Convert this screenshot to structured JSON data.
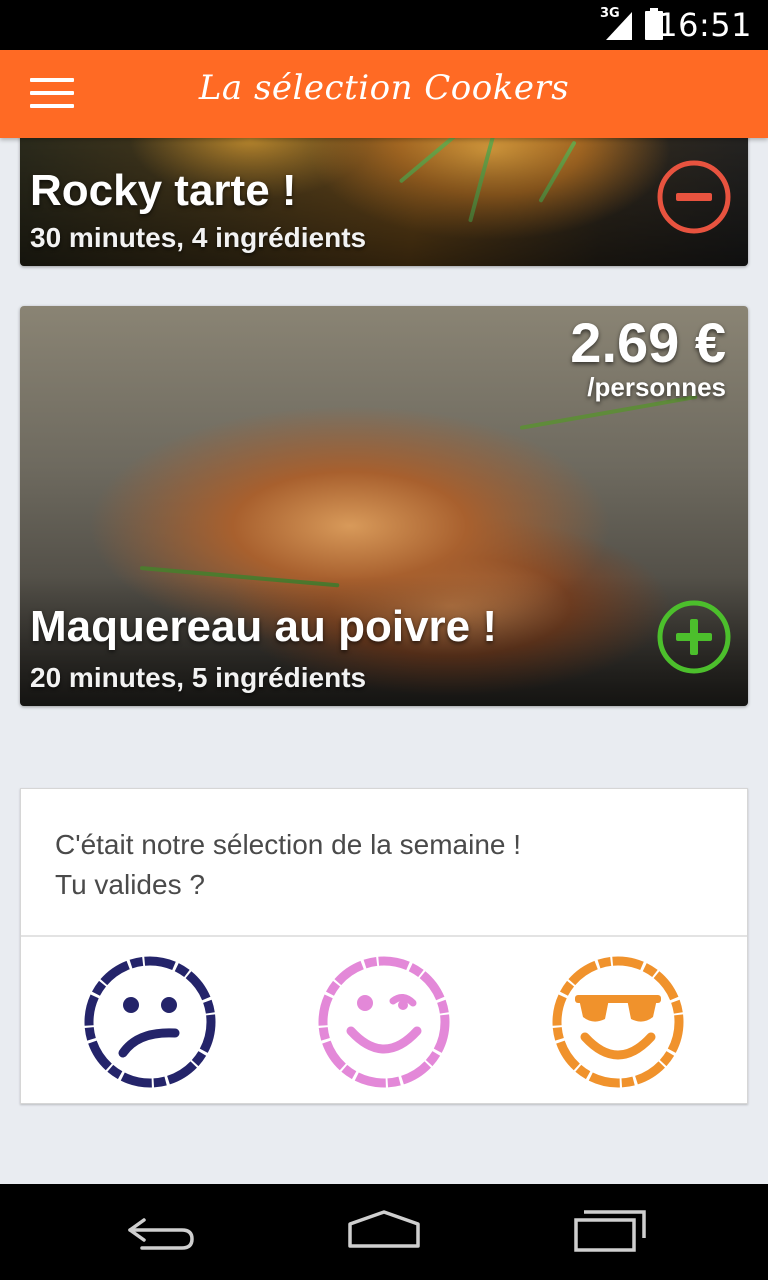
{
  "status_bar": {
    "network": "3G",
    "time": "16:51"
  },
  "app_bar": {
    "title": "La sélection Cookers",
    "menu_icon": "hamburger-menu-icon"
  },
  "recipes": [
    {
      "title": "Rocky tarte !",
      "details": "30 minutes, 4 ingrédients",
      "action": "remove",
      "action_color": "#e8533f"
    },
    {
      "title": "Maquereau au poivre !",
      "details": "20 minutes, 5 ingrédients",
      "price": "2.69 €",
      "price_unit": "/personnes",
      "action": "add",
      "action_color": "#4cbf2c"
    }
  ],
  "validation": {
    "line1": "C'était notre sélection de la semaine !",
    "line2": "Tu valides ?",
    "options": [
      {
        "icon": "sad-face-icon",
        "color": "#24246a"
      },
      {
        "icon": "winking-face-icon",
        "color": "#e388d8"
      },
      {
        "icon": "sunglasses-face-icon",
        "color": "#f0922c"
      }
    ]
  },
  "nav_bar": {
    "icons": [
      "back-icon",
      "home-icon",
      "recent-apps-icon"
    ]
  }
}
